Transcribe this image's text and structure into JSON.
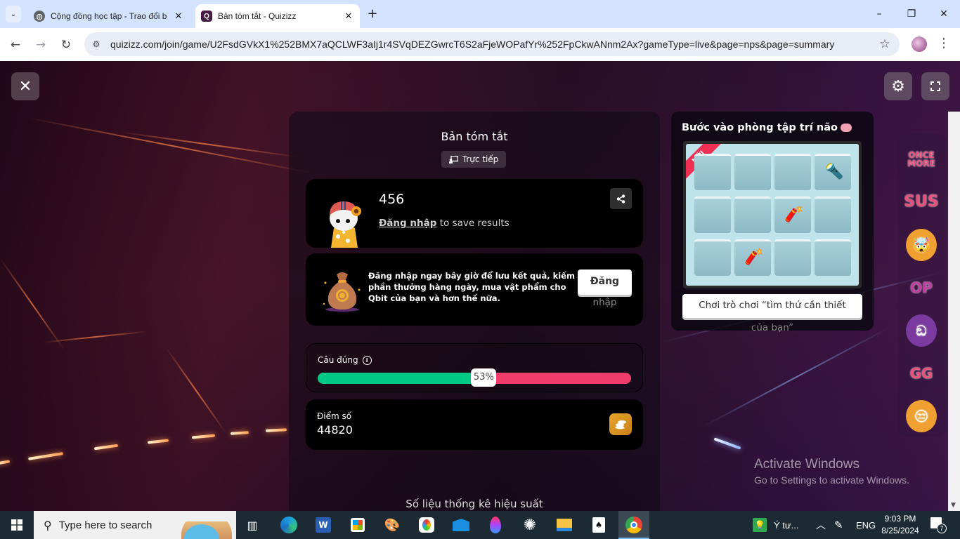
{
  "browser": {
    "tabs": [
      {
        "title": "Cộng đồng học tập - Trao đổi b",
        "favicon": "globe-icon",
        "active": false
      },
      {
        "title": "Bản tóm tắt - Quizizz",
        "favicon": "quizizz-icon",
        "active": true
      }
    ],
    "new_tab_label": "+",
    "url": "quizizz.com/join/game/U2FsdGVkX1%252BMX7aQCLWF3aIj1r4SVqDEZGwrcT6S2aFjeWOPafYr%252FpCkwANnm2Ax?gameType=live&page=nps&page=summary",
    "window_controls": {
      "minimize": "–",
      "restore": "❐",
      "close": "✕"
    }
  },
  "page": {
    "close_label": "✕",
    "summary_title": "Bản tóm tắt",
    "live_chip": "Trực tiếp",
    "player": {
      "name": "456",
      "login_link": "Đăng nhập",
      "login_suffix": " to save results"
    },
    "promo": {
      "text": "Đăng nhập ngay bây giờ để lưu kết quả, kiếm phần thưởng hàng ngày, mua vật phẩm cho Qbit của bạn và hơn thế nữa.",
      "button_line1": "Đăng",
      "button_line2": "nhập"
    },
    "accuracy": {
      "label": "Câu đúng",
      "percent": 53,
      "percent_label": "53%",
      "correct_color": "#00c985",
      "incorrect_color": "#ef3c6a"
    },
    "score": {
      "label": "Điểm số",
      "value": "44820"
    },
    "stats_title": "Số liệu thống kê hiệu suất",
    "brain_panel": {
      "title": "Bước vào phòng tập trí não",
      "ribbon": "MỚI",
      "play_line1": "Chơi trò chơi “tìm thứ cần thiết",
      "play_line2": "của bạn”"
    },
    "reactions": [
      {
        "name": "once-more",
        "label": "ONCE MORE"
      },
      {
        "name": "sus",
        "label": "SUS"
      },
      {
        "name": "mind-blown",
        "label": "🤯"
      },
      {
        "name": "op",
        "label": "OP"
      },
      {
        "name": "among-us",
        "label": "ඞ"
      },
      {
        "name": "gg",
        "label": "GG"
      },
      {
        "name": "loser",
        "label": "😒"
      }
    ],
    "watermark": {
      "line1": "Activate Windows",
      "line2": "Go to Settings to activate Windows."
    }
  },
  "taskbar": {
    "search_placeholder": "Type here to search",
    "tray_app_label": "Ý tư...",
    "language": "ENG",
    "time": "9:03 PM",
    "date": "8/25/2024",
    "notification_count": "7"
  }
}
